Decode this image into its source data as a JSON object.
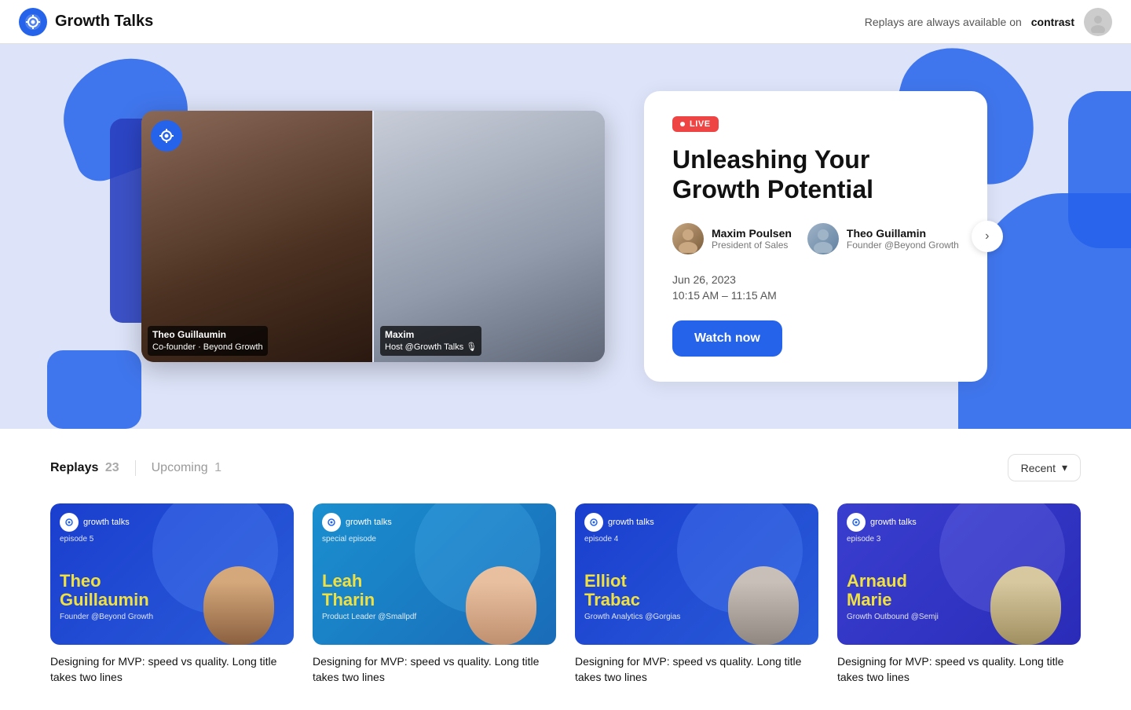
{
  "app": {
    "logo_symbol": "⊕",
    "title": "Growth Talks"
  },
  "header": {
    "replay_text": "Replays are always available on",
    "contrast_text": "contrast"
  },
  "hero": {
    "live_badge": "LIVE",
    "session_title_line1": "Unleashing Your",
    "session_title_line2": "Growth Potential",
    "speakers": [
      {
        "name": "Maxim Poulsen",
        "role": "President of Sales",
        "avatar_class": "av-maxim"
      },
      {
        "name": "Theo Guillamin",
        "role": "Founder @Beyond Growth",
        "avatar_class": "av-theo"
      }
    ],
    "date": "Jun 26, 2023",
    "time": "10:15 AM – 11:15 AM",
    "watch_button": "Watch now",
    "video_left": {
      "person_name": "Theo Guillaumin",
      "person_role": "Co-founder · Beyond Growth"
    },
    "video_right": {
      "person_name": "Maxim",
      "person_role": "Host @Growth Talks 🎙"
    }
  },
  "tabs": {
    "replays_label": "Replays",
    "replays_count": "23",
    "upcoming_label": "Upcoming",
    "upcoming_count": "1"
  },
  "sort": {
    "label": "Recent",
    "icon": "▾"
  },
  "cards": [
    {
      "logo_text": "growth talks",
      "episode_label": "episode 5",
      "person_name": "Theo\nGuillaumin",
      "person_role": "Founder @Beyond Growth",
      "card_color": "card-blue",
      "face_color": "fc-1",
      "card_title": "Designing for MVP: speed vs quality. Long title takes two lines"
    },
    {
      "logo_text": "growth talks",
      "episode_label": "special episode",
      "person_name": "Leah\nTharin",
      "person_role": "Product Leader @Smallpdf",
      "card_color": "card-teal",
      "face_color": "fc-3",
      "card_title": "Designing for MVP: speed vs quality. Long title takes two lines"
    },
    {
      "logo_text": "growth talks",
      "episode_label": "episode 4",
      "person_name": "Elliot\nTrabac",
      "person_role": "Growth Analytics @Gorgias",
      "card_color": "card-blue",
      "face_color": "fc-4",
      "card_title": "Designing for MVP: speed vs quality. Long title takes two lines"
    },
    {
      "logo_text": "growth talks",
      "episode_label": "episode 3",
      "person_name": "Arnaud\nMarie",
      "person_role": "Growth Outbound @Semji",
      "card_color": "card-indigo",
      "face_color": "fc-5",
      "card_title": "Designing for MVP: speed vs quality. Long title takes two lines"
    }
  ]
}
